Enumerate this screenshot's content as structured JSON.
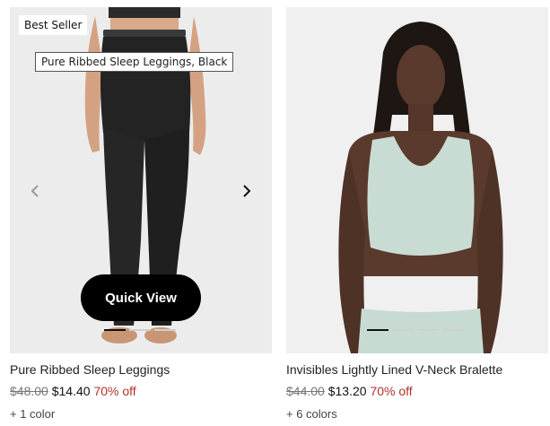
{
  "products": [
    {
      "badge": "Best Seller",
      "tooltip": "Pure Ribbed Sleep Leggings, Black",
      "quick_view": "Quick View",
      "name": "Pure Ribbed Sleep Leggings",
      "original_price": "$48.00",
      "sale_price": "$14.40",
      "discount": "70% off",
      "colors": "+ 1 color",
      "carousel_index": 1,
      "carousel_count": 4,
      "icons": {
        "prev": "chevron-left-icon",
        "next": "chevron-right-icon"
      }
    },
    {
      "name": "Invisibles Lightly Lined V-Neck Bralette",
      "original_price": "$44.00",
      "sale_price": "$13.20",
      "discount": "70% off",
      "colors": "+ 6 colors",
      "carousel_index": 1,
      "carousel_count": 4
    }
  ],
  "colors": {
    "discount": "#b0322b",
    "quick_view_bg": "#000000",
    "active_dot": "#111111"
  }
}
